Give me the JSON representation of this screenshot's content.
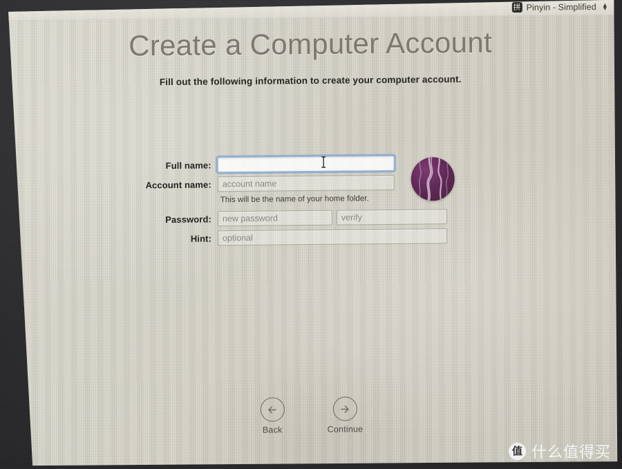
{
  "menubar": {
    "ime_icon": "pinyin-ime-icon",
    "ime_icon_glyph": "拼",
    "input_source": "Pinyin - Simplified",
    "chevron_up": "▲",
    "chevron_down": "▼"
  },
  "page": {
    "title": "Create a Computer Account",
    "subtitle": "Fill out the following information to create your computer account."
  },
  "form": {
    "fields": [
      {
        "label": "Full name:",
        "value": "",
        "placeholder": "",
        "focused": true
      },
      {
        "label": "Account name:",
        "value": "",
        "placeholder": "account name",
        "focused": false
      },
      {
        "label": "Password:",
        "value": "",
        "placeholder": "new password",
        "focused": false
      },
      {
        "label": "Hint:",
        "value": "",
        "placeholder": "optional",
        "focused": false
      }
    ],
    "verify_placeholder": "verify",
    "helper_text": "This will be the name of your home folder.",
    "avatar": {
      "name": "user-avatar",
      "color": "#612a58",
      "accent_color": "#d7b8d0"
    }
  },
  "nav": {
    "back": {
      "label": "Back",
      "icon": "arrow-left-circle-icon"
    },
    "continue": {
      "label": "Continue",
      "icon": "arrow-right-circle-icon"
    }
  },
  "cursor": {
    "type": "i-beam-cursor"
  },
  "watermark": {
    "logo_glyph": "值",
    "text": "什么值得买"
  },
  "colors": {
    "screen_background": "#d5d3c7",
    "title_text": "#7e786e",
    "label_text": "#232220",
    "focus_ring": "#7aa2d0",
    "bezel": "#2e2e31"
  }
}
